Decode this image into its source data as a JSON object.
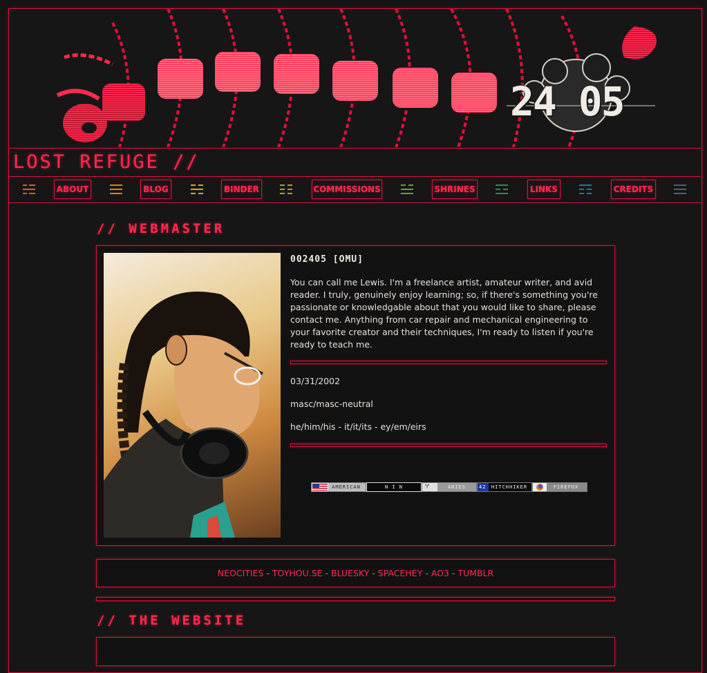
{
  "site": {
    "banner_stamp": "24 05",
    "title": "LOST REFUGE //"
  },
  "nav": {
    "items": [
      {
        "label": "ABOUT"
      },
      {
        "label": "BLOG"
      },
      {
        "label": "BINDER"
      },
      {
        "label": "COMMISSIONS"
      },
      {
        "label": "SHRINES"
      },
      {
        "label": "LINKS"
      },
      {
        "label": "CREDITS"
      }
    ],
    "icon_colors": [
      "#e8581c",
      "#f07a1a",
      "#e8a418",
      "#b8a020",
      "#7a9a28",
      "#2e8a5a",
      "#1a7aa0",
      "#5a5a80"
    ]
  },
  "webmaster": {
    "section_title": "// WEBMASTER",
    "heading": "002405 [OMU]",
    "bio": "You can call me Lewis. I'm a freelance artist, amateur writer, and avid reader. I truly, genuinely enjoy learning; so, if there's something you're passionate or knowledgable about that you would like to share, please contact me. Anything from car repair and mechanical engineering to your favorite creator and their techniques, I'm ready to listen if you're ready to teach me.",
    "birthday": "03/31/2002",
    "gender": "masc/masc-neutral",
    "pronouns": "he/him/his - it/it/its - ey/em/eirs",
    "badges": [
      {
        "label": "AMERICAN"
      },
      {
        "label": "N I N"
      },
      {
        "label": "ARIES"
      },
      {
        "label": "HITCHHIKER"
      },
      {
        "label": "FIREFOX"
      }
    ]
  },
  "social": {
    "links": [
      "NEOCITIES",
      "TOYHOU.SE",
      "BLUESKY",
      "SPACEHEY",
      "AO3",
      "TUMBLR"
    ],
    "separator": " - "
  },
  "website": {
    "section_title": "// THE WEBSITE"
  },
  "colors": {
    "accent": "#e0103a",
    "accent_text": "#ff2a4e",
    "background": "#141414"
  }
}
